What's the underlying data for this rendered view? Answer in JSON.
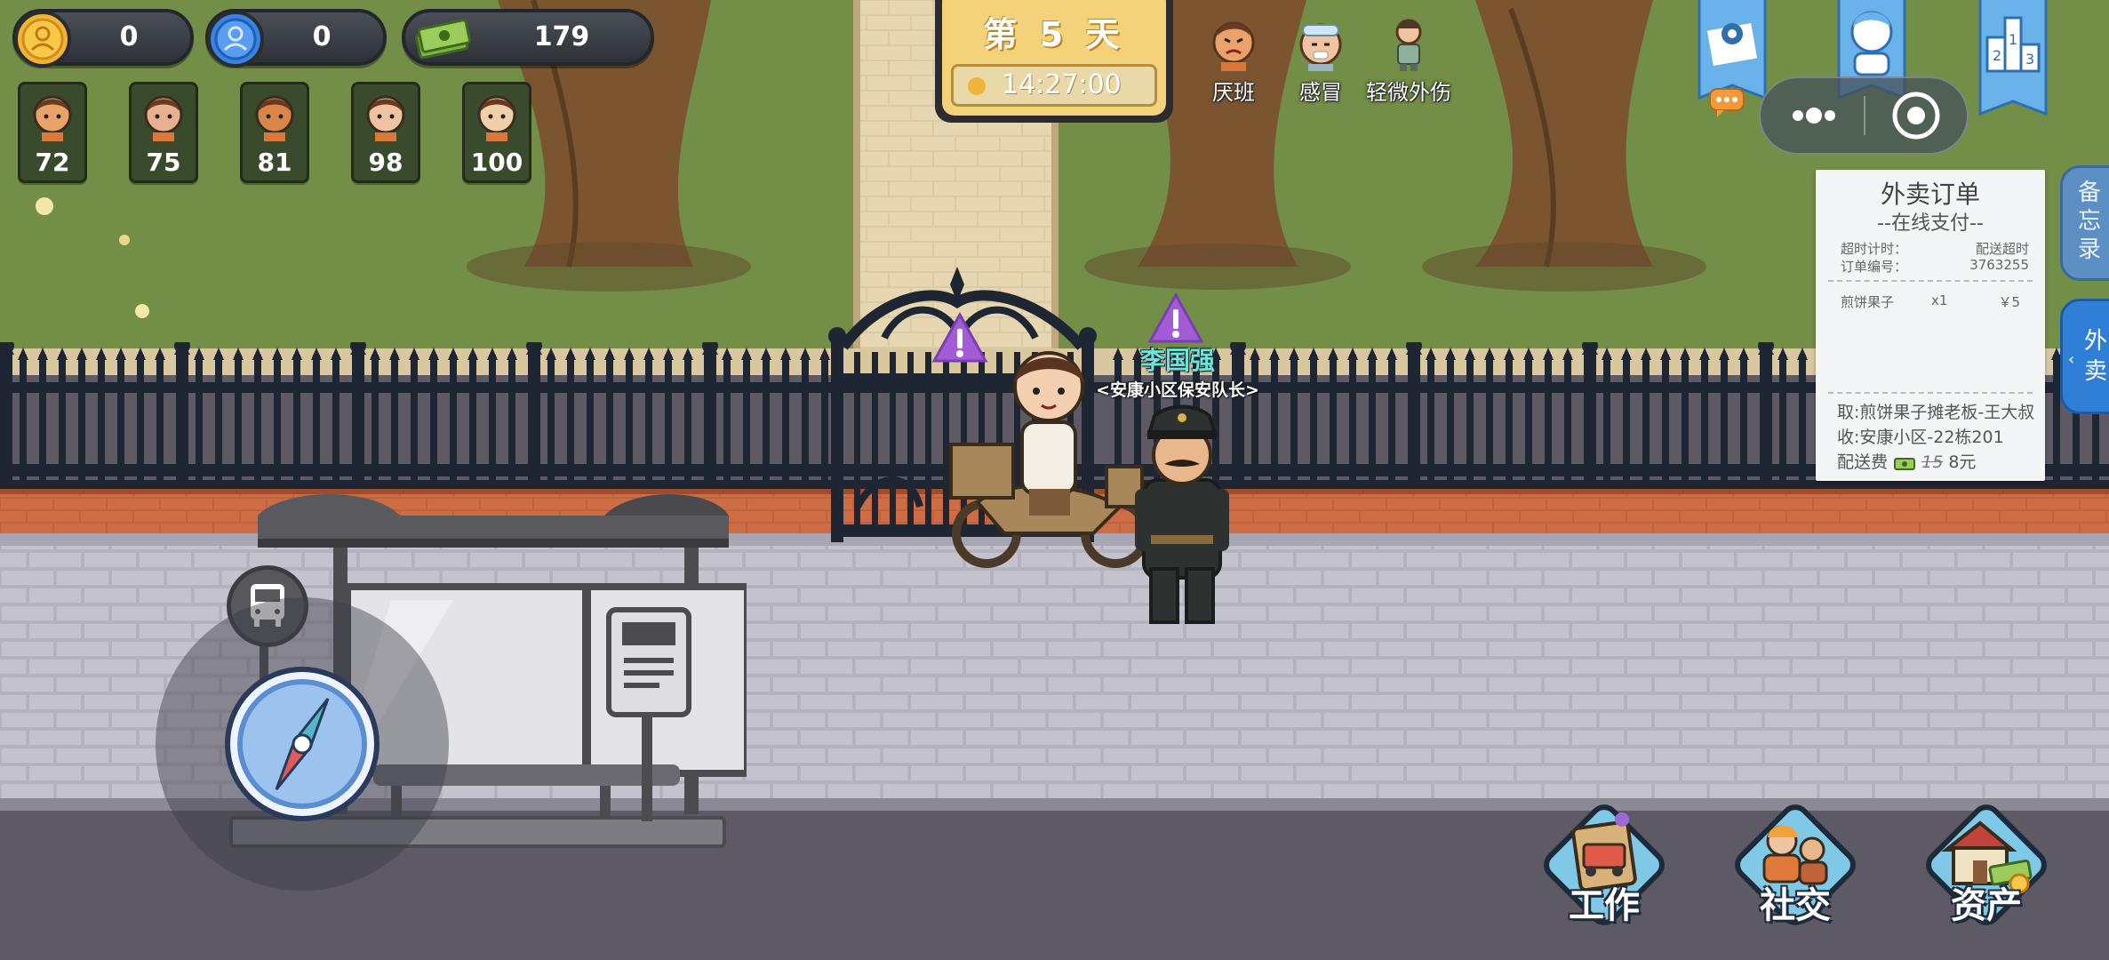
{
  "hud": {
    "coins": "0",
    "followers": "0",
    "money": "179"
  },
  "stats": [
    "72",
    "75",
    "81",
    "98",
    "100"
  ],
  "day": {
    "prefix": "第",
    "number": "5",
    "suffix": "天",
    "time": "14:27:00"
  },
  "conditions": [
    {
      "label": "厌班",
      "icon": "grumpy-face-icon"
    },
    {
      "label": "感冒",
      "icon": "sick-face-icon"
    },
    {
      "label": "轻微外伤",
      "icon": "injured-person-icon"
    }
  ],
  "top_right_icons": [
    "map-icon",
    "character-icon",
    "ranking-icon",
    "chat-icon",
    "more-icon",
    "record-icon"
  ],
  "side_tabs": {
    "memo": "备忘录",
    "delivery": "外卖"
  },
  "order": {
    "title": "外卖订单",
    "subtitle": "--在线支付--",
    "timer_label": "超时计时：",
    "timeout_label": "配送超时",
    "order_no_label": "订单编号：",
    "order_no": "3763255",
    "item_name": "煎饼果子",
    "item_qty": "x1",
    "item_price": "￥5",
    "pickup": "取:煎饼果子摊老板-王大叔",
    "deliver_to": "收:安康小区-22栋201",
    "fee_label": "配送费",
    "fee_old": "15",
    "fee_new": "8元"
  },
  "npc": {
    "name": "李国强",
    "title": "<安康小区保安队长>"
  },
  "bottom_buttons": {
    "work": "工作",
    "social": "社交",
    "assets": "资产"
  },
  "colors": {
    "grass": "#6e8a42",
    "path": "#e2cfa8",
    "sidewalk": "#b8b6c0",
    "road": "#5d5a66",
    "fence": "#1f2633",
    "warning": "#a15cd6",
    "npc_name": "#6fe3d6",
    "tab_blue": "#2f7fd6",
    "day_gold": "#f4d27a"
  }
}
